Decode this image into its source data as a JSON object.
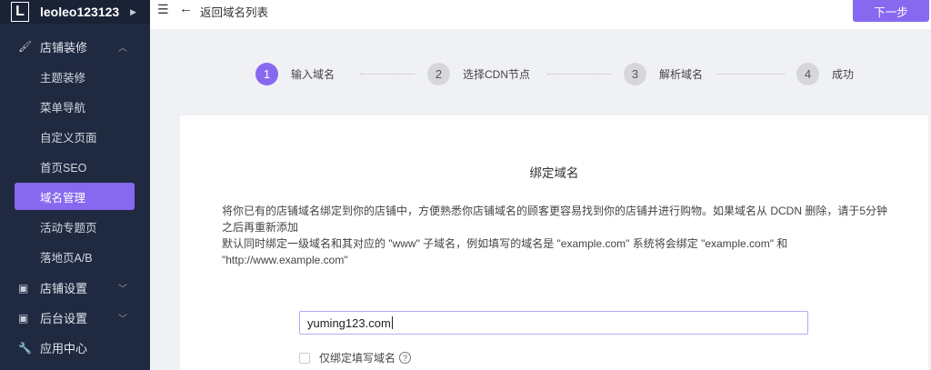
{
  "sidebar": {
    "logo_letter": "L",
    "shop_name": "leoleo123123",
    "group_store": {
      "icon": "brush-icon",
      "label": "店铺装修"
    },
    "items": [
      {
        "label": "主题装修"
      },
      {
        "label": "菜单导航"
      },
      {
        "label": "自定义页面"
      },
      {
        "label": "首页SEO"
      },
      {
        "label": "域名管理",
        "active": true
      },
      {
        "label": "活动专题页"
      },
      {
        "label": "落地页A/B"
      }
    ],
    "groups": [
      {
        "icon": "store-icon",
        "label": "店铺设置"
      },
      {
        "icon": "monitor-icon",
        "label": "后台设置"
      },
      {
        "icon": "wrench-icon",
        "label": "应用中心"
      }
    ]
  },
  "topbar": {
    "back_label": "返回域名列表",
    "next_label": "下一步"
  },
  "steps": [
    {
      "num": "1",
      "label": "输入域名",
      "active": true
    },
    {
      "num": "2",
      "label": "选择CDN节点"
    },
    {
      "num": "3",
      "label": "解析域名"
    },
    {
      "num": "4",
      "label": "成功"
    }
  ],
  "card": {
    "title": "绑定域名",
    "desc1": "将你已有的店铺域名绑定到你的店铺中，方便熟悉你店铺域名的顾客更容易找到你的店铺并进行购物。如果域名从 DCDN 删除，请于5分钟之后再重新添加",
    "desc2": "默认同时绑定一级域名和其对应的 \"www\" 子域名，例如填写的域名是 \"example.com\" 系统将会绑定 \"example.com\" 和 \"http://www.example.com\"",
    "domain_value": "yuming123.com",
    "checkbox_label": "仅绑定填写域名"
  },
  "colors": {
    "accent": "#8769f0",
    "sidebar_bg": "#1f2940"
  }
}
